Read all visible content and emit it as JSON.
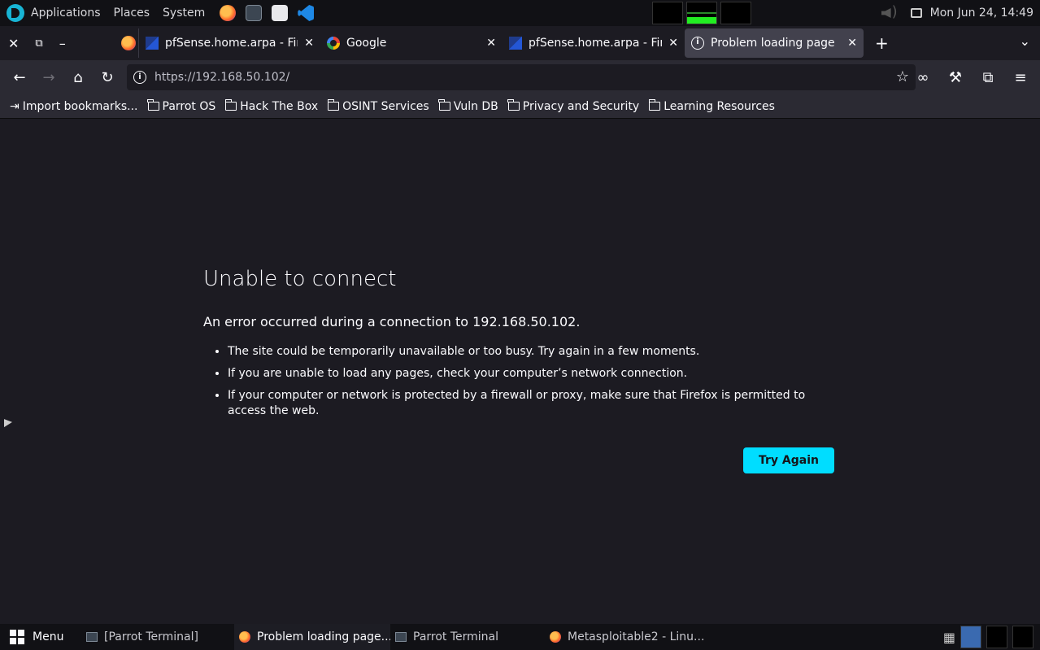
{
  "topbar": {
    "menus": [
      "Applications",
      "Places",
      "System"
    ],
    "clock": "Mon Jun 24, 14:49"
  },
  "tabs": [
    {
      "title": "pfSense.home.arpa - Firef",
      "icon": "pfsense-icon",
      "active": false
    },
    {
      "title": "Google",
      "icon": "google-icon",
      "active": false
    },
    {
      "title": "pfSense.home.arpa - Firef",
      "icon": "pfsense-icon",
      "active": false
    },
    {
      "title": "Problem loading page",
      "icon": "info-icon",
      "active": true
    }
  ],
  "urlbar": {
    "url": "https://192.168.50.102/"
  },
  "bookmarks": [
    "Import bookmarks...",
    "Parrot OS",
    "Hack The Box",
    "OSINT Services",
    "Vuln DB",
    "Privacy and Security",
    "Learning Resources"
  ],
  "error": {
    "title": "Unable to connect",
    "description": "An error occurred during a connection to 192.168.50.102.",
    "bullets": [
      "The site could be temporarily unavailable or too busy. Try again in a few moments.",
      "If you are unable to load any pages, check your computer’s network connection.",
      "If your computer or network is protected by a firewall or proxy, make sure that Firefox is permitted to access the web."
    ],
    "button": "Try Again"
  },
  "taskbar": {
    "menu_label": "Menu",
    "items": [
      "[Parrot Terminal]",
      "Problem loading page...",
      "Parrot Terminal",
      "Metasploitable2 - Linu..."
    ]
  },
  "colors": {
    "accent": "#00ddff",
    "background": "#1c1b22",
    "toolbar": "#2b2a33"
  }
}
